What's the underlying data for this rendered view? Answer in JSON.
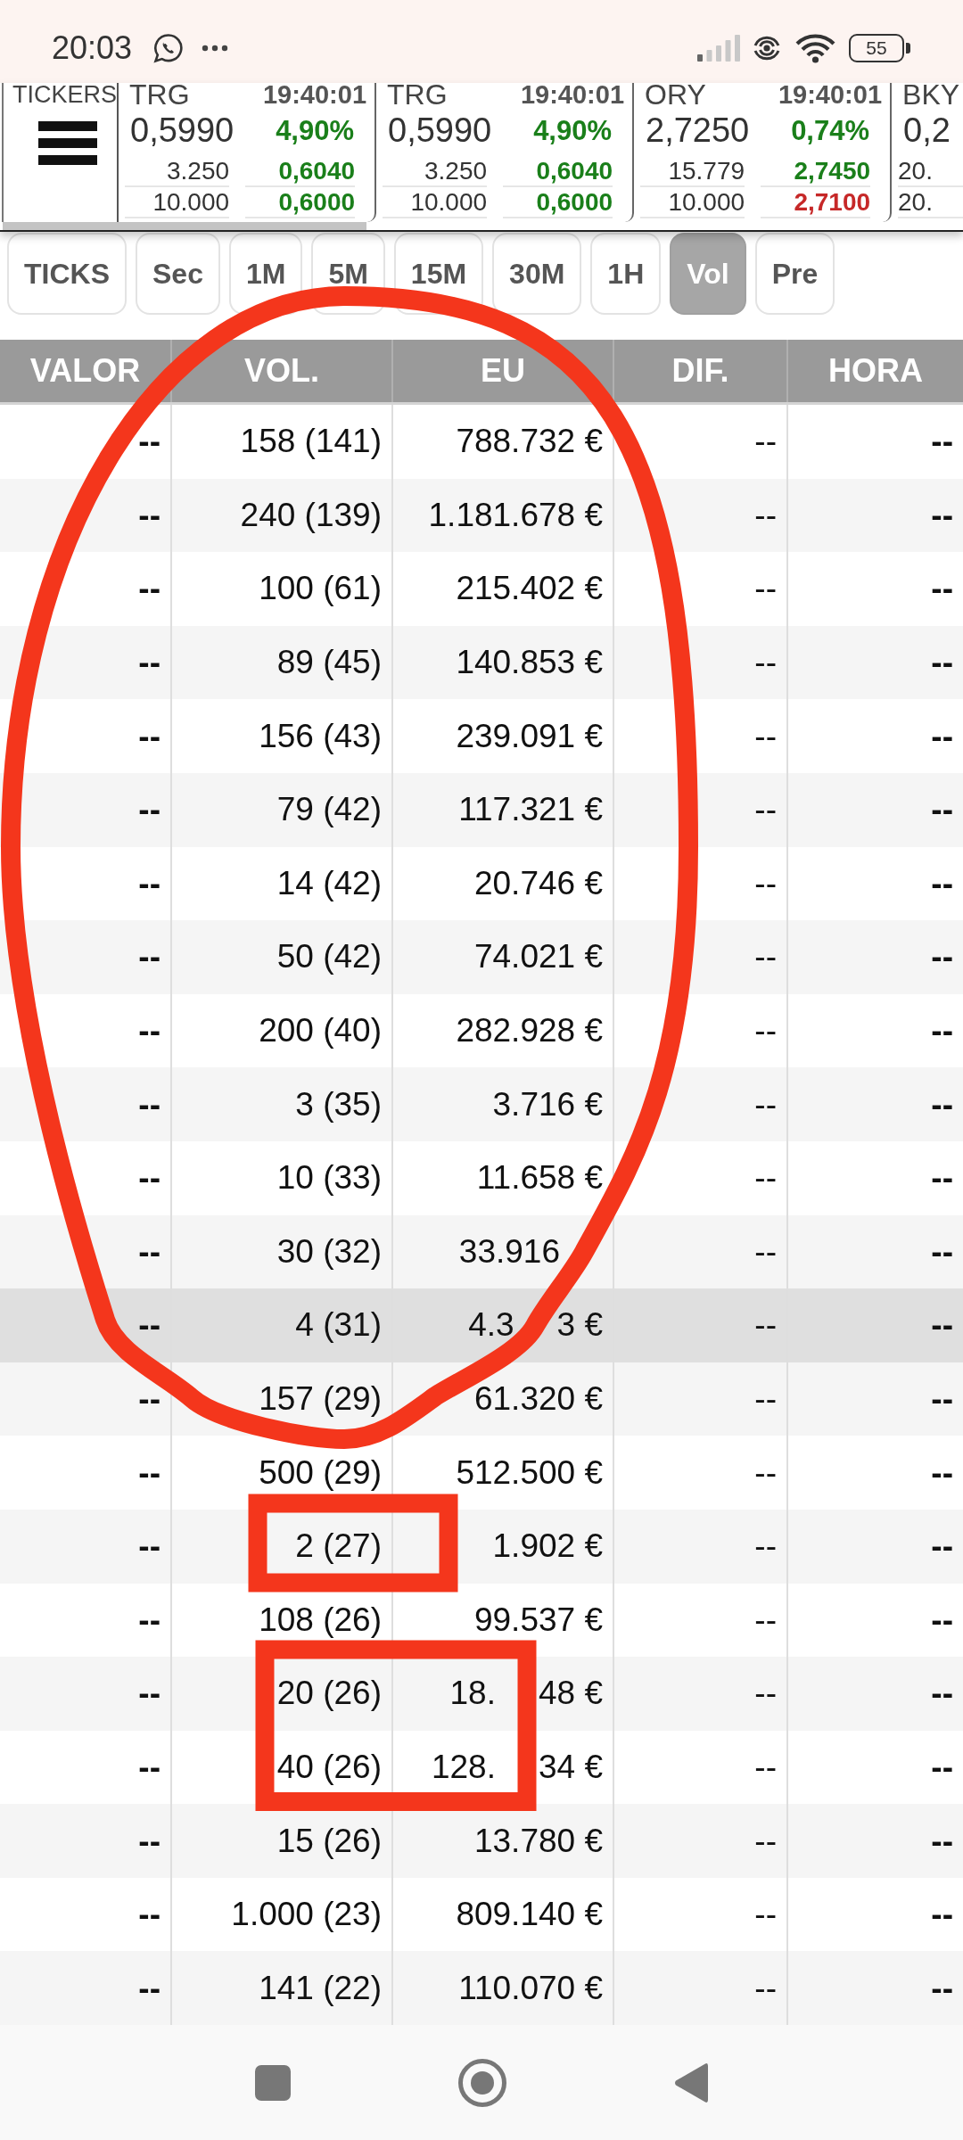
{
  "status_bar": {
    "time": "20:03",
    "battery": "55"
  },
  "ticker_panel": {
    "label": "TICKERS"
  },
  "tickers": [
    {
      "symbol": "TRG",
      "time": "19:40:01",
      "price": "0,5990",
      "change": {
        "text": "4,90%",
        "color": "#1a7f1a"
      },
      "levels": [
        {
          "quantity": "3.250",
          "price": "0,6040",
          "color": "#1a7f1a"
        },
        {
          "quantity": "10.000",
          "price": "0,6000",
          "color": "#1a7f1a"
        }
      ]
    },
    {
      "symbol": "TRG",
      "time": "19:40:01",
      "price": "0,5990",
      "change": {
        "text": "4,90%",
        "color": "#1a7f1a"
      },
      "levels": [
        {
          "quantity": "3.250",
          "price": "0,6040",
          "color": "#1a7f1a"
        },
        {
          "quantity": "10.000",
          "price": "0,6000",
          "color": "#1a7f1a"
        }
      ]
    },
    {
      "symbol": "ORY",
      "time": "19:40:01",
      "price": "2,7250",
      "change": {
        "text": "0,74%",
        "color": "#1a7f1a"
      },
      "levels": [
        {
          "quantity": "15.779",
          "price": "2,7450",
          "color": "#1a7f1a"
        },
        {
          "quantity": "10.000",
          "price": "2,7100",
          "color": "#c62828"
        }
      ]
    },
    {
      "symbol": "BKY",
      "price": "0,2",
      "levels": [
        {
          "quantity": "20."
        },
        {
          "quantity": "20."
        }
      ]
    }
  ],
  "tabs": [
    {
      "label": "TICKS",
      "selected": false
    },
    {
      "label": "Sec",
      "selected": false
    },
    {
      "label": "1M",
      "selected": false
    },
    {
      "label": "5M",
      "selected": false
    },
    {
      "label": "15M",
      "selected": false
    },
    {
      "label": "30M",
      "selected": false
    },
    {
      "label": "1H",
      "selected": false
    },
    {
      "label": "Vol",
      "selected": true
    },
    {
      "label": "Pre",
      "selected": false
    }
  ],
  "table": {
    "columns": [
      "VALOR",
      "VOL.",
      "EU",
      "DIF.",
      "HORA"
    ],
    "rows": [
      {
        "selected": false,
        "cells": [
          "--",
          "158 (141)",
          "788.732 €",
          "--",
          "--"
        ]
      },
      {
        "selected": false,
        "cells": [
          "--",
          "240 (139)",
          "1.181.678 €",
          "--",
          "--"
        ]
      },
      {
        "selected": false,
        "cells": [
          "--",
          "100 (61)",
          "215.402 €",
          "--",
          "--"
        ]
      },
      {
        "selected": false,
        "cells": [
          "--",
          "89 (45)",
          "140.853 €",
          "--",
          "--"
        ]
      },
      {
        "selected": false,
        "cells": [
          "--",
          "156 (43)",
          "239.091 €",
          "--",
          "--"
        ]
      },
      {
        "selected": false,
        "cells": [
          "--",
          "79 (42)",
          "117.321 €",
          "--",
          "--"
        ]
      },
      {
        "selected": false,
        "cells": [
          "--",
          "14 (42)",
          "20.746 €",
          "--",
          "--"
        ]
      },
      {
        "selected": false,
        "cells": [
          "--",
          "50 (42)",
          "74.021 €",
          "--",
          "--"
        ]
      },
      {
        "selected": false,
        "cells": [
          "--",
          "200 (40)",
          "282.928 €",
          "--",
          "--"
        ]
      },
      {
        "selected": false,
        "cells": [
          "--",
          "3 (35)",
          "3.716 €",
          "--",
          "--"
        ]
      },
      {
        "selected": false,
        "cells": [
          "--",
          "10 (33)",
          "11.658 €",
          "--",
          "--"
        ]
      },
      {
        "selected": false,
        "cells": [
          "--",
          "30 (32)",
          [
            "33.916",
            null
          ],
          "--",
          "--"
        ]
      },
      {
        "selected": true,
        "cells": [
          "--",
          "4 (31)",
          [
            "4.3",
            null,
            "3 €"
          ],
          "--",
          "--"
        ]
      },
      {
        "selected": false,
        "cells": [
          "--",
          "157 (29)",
          "61.320 €",
          "--",
          "--"
        ]
      },
      {
        "selected": false,
        "cells": [
          "--",
          "500 (29)",
          "512.500 €",
          "--",
          "--"
        ]
      },
      {
        "selected": false,
        "cells": [
          "--",
          "2 (27)",
          "1.902 €",
          "--",
          "--"
        ]
      },
      {
        "selected": false,
        "cells": [
          "--",
          "108 (26)",
          "99.537 €",
          "--",
          "--"
        ]
      },
      {
        "selected": false,
        "cells": [
          "--",
          "20 (26)",
          [
            "18.",
            null,
            "48 €"
          ],
          "--",
          "--"
        ]
      },
      {
        "selected": false,
        "cells": [
          "--",
          "40 (26)",
          [
            "128.",
            null,
            "34 €"
          ],
          "--",
          "--"
        ]
      },
      {
        "selected": false,
        "cells": [
          "--",
          "15 (26)",
          "13.780 €",
          "--",
          "--"
        ]
      },
      {
        "selected": false,
        "cells": [
          "--",
          "1.000 (23)",
          "809.140 €",
          "--",
          "--"
        ]
      },
      {
        "selected": false,
        "cells": [
          "--",
          "141 (22)",
          "110.070 €",
          "--",
          "--"
        ]
      }
    ]
  },
  "annotations": [
    {
      "kind": "ellipse"
    },
    {
      "kind": "rectangle"
    },
    {
      "kind": "rectangle"
    }
  ]
}
